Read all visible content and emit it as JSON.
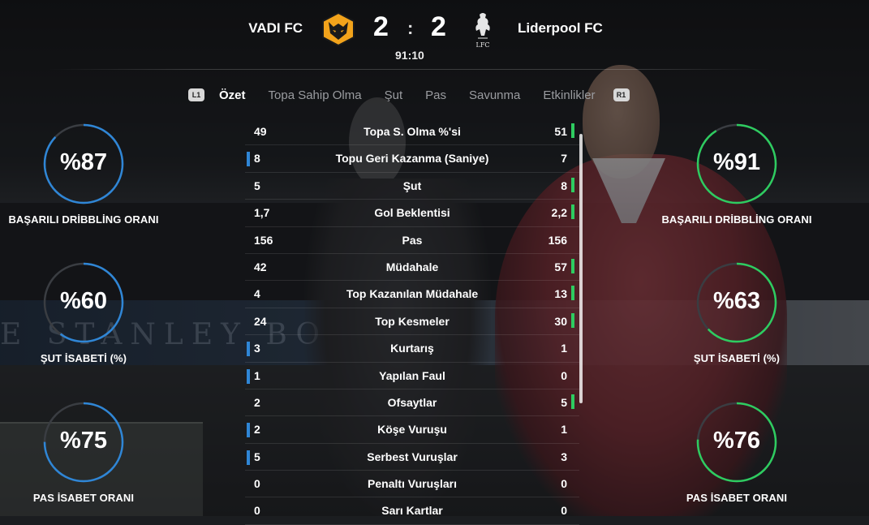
{
  "match": {
    "home_team": "VADI FC",
    "away_team": "Liderpool FC",
    "home_score": "2",
    "separator": ":",
    "away_score": "2",
    "clock": "91:10",
    "away_crest_text": "LFC"
  },
  "tabs": {
    "left_hint": "L1",
    "right_hint": "R1",
    "items": [
      "Özet",
      "Topa Sahip Olma",
      "Şut",
      "Pas",
      "Savunma",
      "Etkinlikler"
    ],
    "active_index": 0
  },
  "stats": [
    {
      "label": "Topa S. Olma %'si",
      "home": "49",
      "away": "51",
      "leader": "away"
    },
    {
      "label": "Topu Geri Kazanma (Saniye)",
      "home": "8",
      "away": "7",
      "leader": "home"
    },
    {
      "label": "Şut",
      "home": "5",
      "away": "8",
      "leader": "away"
    },
    {
      "label": "Gol Beklentisi",
      "home": "1,7",
      "away": "2,2",
      "leader": "away"
    },
    {
      "label": "Pas",
      "home": "156",
      "away": "156",
      "leader": "none"
    },
    {
      "label": "Müdahale",
      "home": "42",
      "away": "57",
      "leader": "away"
    },
    {
      "label": "Top Kazanılan Müdahale",
      "home": "4",
      "away": "13",
      "leader": "away"
    },
    {
      "label": "Top Kesmeler",
      "home": "24",
      "away": "30",
      "leader": "away"
    },
    {
      "label": "Kurtarış",
      "home": "3",
      "away": "1",
      "leader": "home"
    },
    {
      "label": "Yapılan Faul",
      "home": "1",
      "away": "0",
      "leader": "home"
    },
    {
      "label": "Ofsaytlar",
      "home": "2",
      "away": "5",
      "leader": "away"
    },
    {
      "label": "Köşe Vuruşu",
      "home": "2",
      "away": "1",
      "leader": "home"
    },
    {
      "label": "Serbest Vuruşlar",
      "home": "5",
      "away": "3",
      "leader": "home"
    },
    {
      "label": "Penaltı Vuruşları",
      "home": "0",
      "away": "0",
      "leader": "none"
    },
    {
      "label": "Sarı Kartlar",
      "home": "0",
      "away": "0",
      "leader": "none"
    }
  ],
  "rings": {
    "home": [
      {
        "value_text": "%87",
        "percent": 87,
        "label": "BAŞARILI DRİBBLİNG ORANI"
      },
      {
        "value_text": "%60",
        "percent": 60,
        "label": "ŞUT İSABETİ (%)"
      },
      {
        "value_text": "%75",
        "percent": 75,
        "label": "PAS İSABET ORANI"
      }
    ],
    "away": [
      {
        "value_text": "%91",
        "percent": 91,
        "label": "BAŞARILI DRİBBLİNG ORANI"
      },
      {
        "value_text": "%63",
        "percent": 63,
        "label": "ŞUT İSABETİ (%)"
      },
      {
        "value_text": "%76",
        "percent": 76,
        "label": "PAS İSABET ORANI"
      }
    ]
  },
  "background": {
    "stand_text": "E STANLEY BOWLES"
  },
  "colors": {
    "home_accent": "#2f86d6",
    "away_accent": "#2ecc60",
    "ring_track": "#3a3d42"
  }
}
